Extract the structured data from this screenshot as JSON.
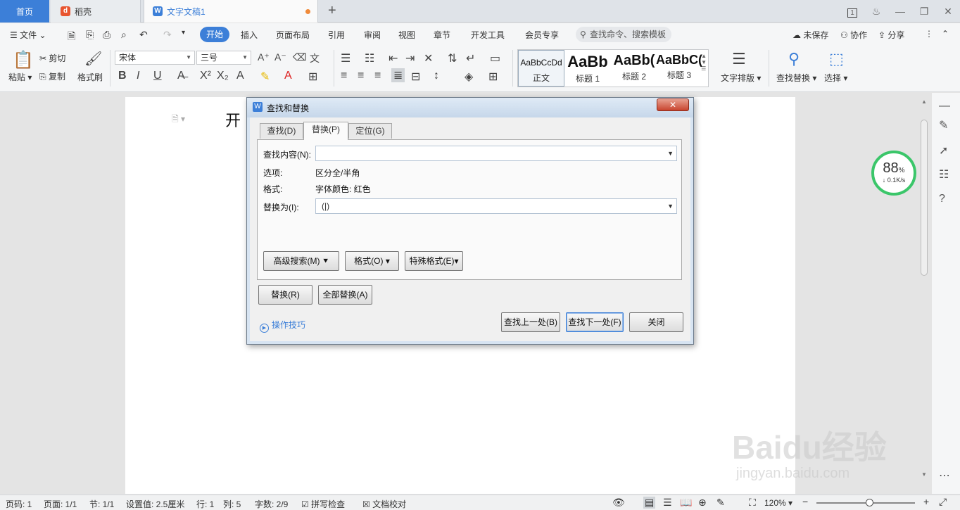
{
  "tabs": {
    "home": "首页",
    "daoke": "稻壳",
    "doc": "文字文稿1",
    "add": "+",
    "badge": "1"
  },
  "menu": {
    "file": "文件",
    "items": [
      "开始",
      "插入",
      "页面布局",
      "引用",
      "审阅",
      "视图",
      "章节",
      "开发工具",
      "会员专享"
    ],
    "search_placeholder": "查找命令、搜索模板",
    "unsaved": "未保存",
    "collab": "协作",
    "share": "分享"
  },
  "ribbon": {
    "paste": "粘贴",
    "cut": "剪切",
    "copy": "复制",
    "format_painter": "格式刷",
    "font_name": "宋体",
    "font_size": "三号",
    "styles": [
      {
        "sample": "AaBbCcDd",
        "name": "正文"
      },
      {
        "sample": "AaBb",
        "name": "标题 1"
      },
      {
        "sample": "AaBb(",
        "name": "标题 2"
      },
      {
        "sample": "AaBbC(",
        "name": "标题 3"
      }
    ],
    "text_layout": "文字排版",
    "find_replace": "查找替换",
    "select": "选择"
  },
  "document": {
    "text": "开"
  },
  "speed": {
    "percent": "88",
    "unit": "%",
    "rate": "0.1K/s"
  },
  "dialog": {
    "title": "查找和替换",
    "close": "✕",
    "tabs": [
      "查找(D)",
      "替换(P)",
      "定位(G)"
    ],
    "find_label": "查找内容(N):",
    "find_value": "",
    "options_label": "选项:",
    "options_value": "区分全/半角",
    "format_label": "格式:",
    "format_value": "字体颜色: 红色",
    "replace_label": "替换为(I):",
    "replace_value": "(|)",
    "advanced": "高级搜索(M)",
    "format_btn": "格式(O)",
    "special_btn": "特殊格式(E)",
    "replace_btn": "替换(R)",
    "replace_all_btn": "全部替换(A)",
    "tips": "操作技巧",
    "find_prev": "查找上一处(B)",
    "find_next": "查找下一处(F)",
    "close_btn": "关闭"
  },
  "status": {
    "page_no": "页码: 1",
    "pages": "页面: 1/1",
    "section": "节: 1/1",
    "setting": "设置值: 2.5厘米",
    "row": "行: 1",
    "col": "列: 5",
    "words": "字数: 2/9",
    "spell": "拼写检查",
    "proof": "文档校对",
    "zoom": "120%"
  },
  "watermark": {
    "main": "Baidu经验",
    "sub": "jingyan.baidu.com"
  },
  "colors": {
    "accent": "#3c7fd8",
    "ring": "#3bc66a",
    "close_red": "#c8442e"
  }
}
